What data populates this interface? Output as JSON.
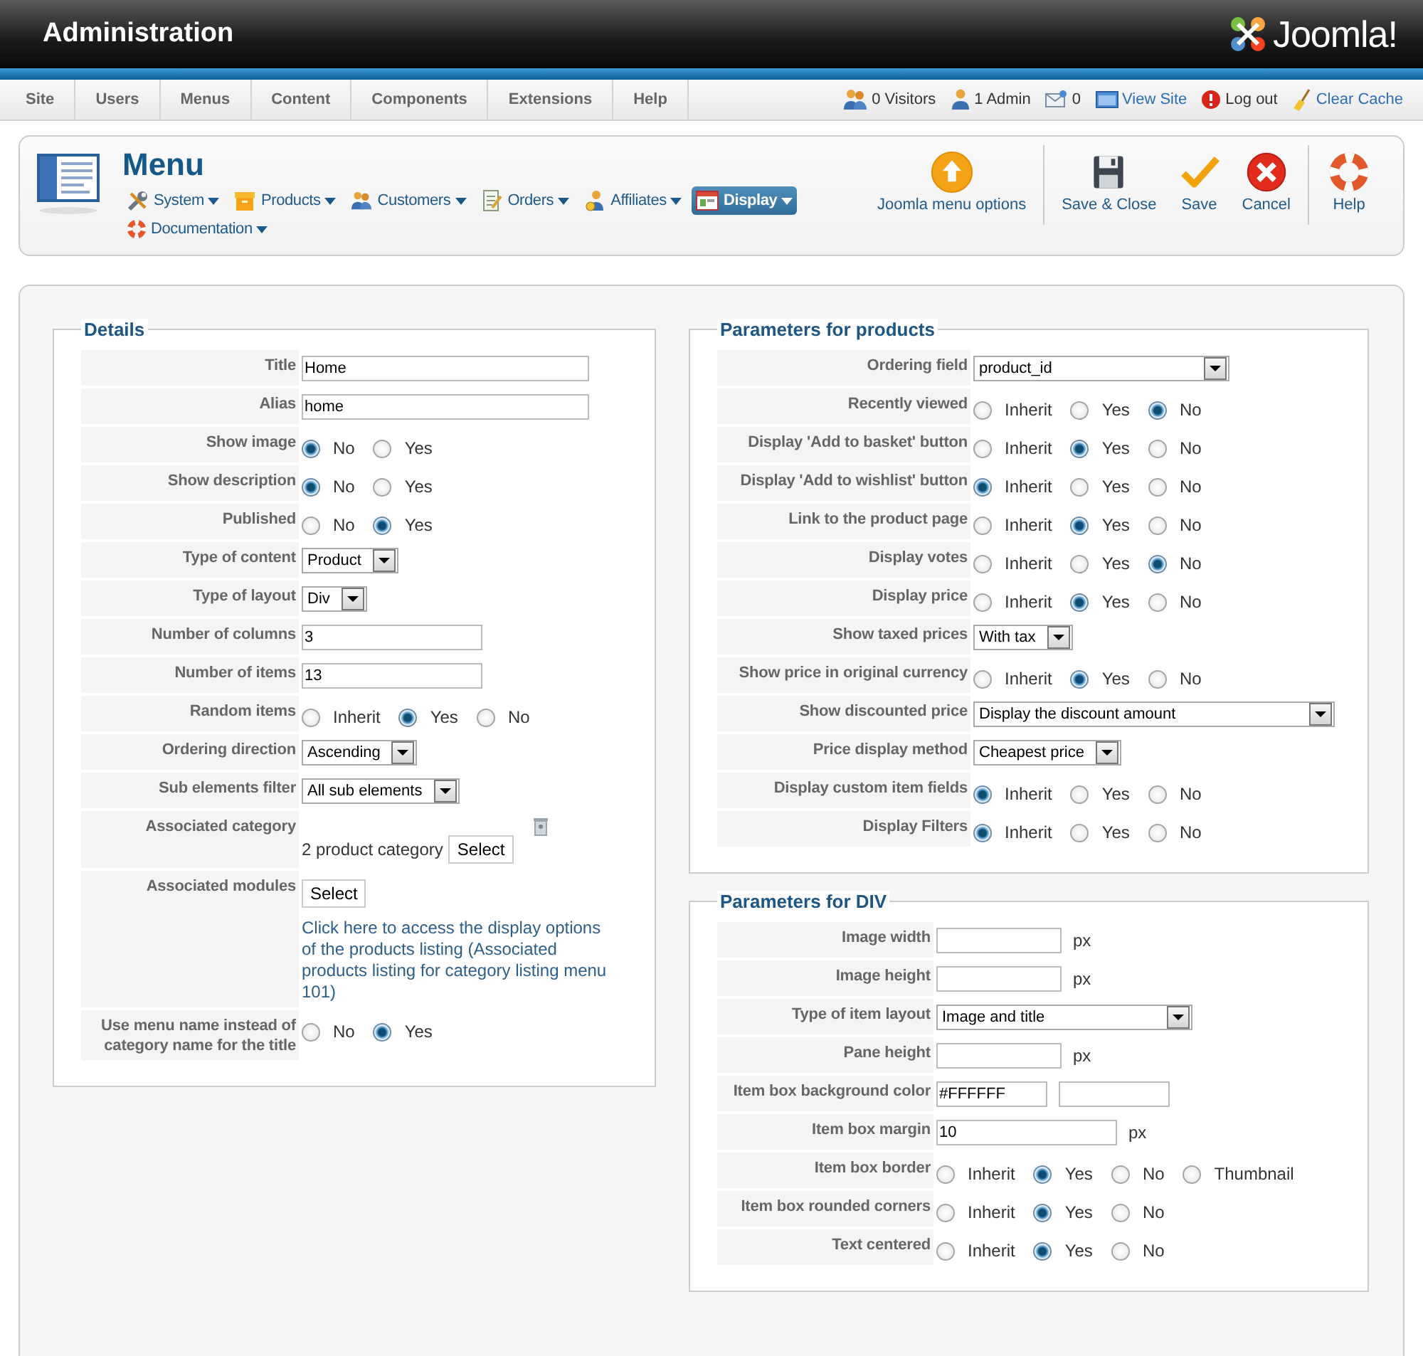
{
  "header": {
    "title": "Administration",
    "logo": "Joomla!"
  },
  "menu": [
    "Site",
    "Users",
    "Menus",
    "Content",
    "Components",
    "Extensions",
    "Help"
  ],
  "status": [
    {
      "kind": "visitors",
      "text": "0 Visitors"
    },
    {
      "kind": "admin",
      "text": "1 Admin"
    },
    {
      "kind": "messages",
      "text": "0"
    },
    {
      "kind": "view-site",
      "text": "View Site"
    },
    {
      "kind": "logout",
      "text": "Log out"
    },
    {
      "kind": "cache",
      "text": "Clear Cache"
    }
  ],
  "toolbar": {
    "title": "Menu",
    "nav": [
      {
        "label": "System",
        "kind": "tools",
        "selected": false
      },
      {
        "label": "Products",
        "kind": "box",
        "selected": false
      },
      {
        "label": "Customers",
        "kind": "people",
        "selected": false
      },
      {
        "label": "Orders",
        "kind": "document",
        "selected": false
      },
      {
        "label": "Affiliates",
        "kind": "coin",
        "selected": false
      },
      {
        "label": "Display",
        "kind": "window",
        "selected": true
      },
      {
        "label": "Documentation",
        "kind": "lifebuoy",
        "selected": false
      }
    ],
    "buttons": [
      {
        "kind": "options",
        "label": "Joomla menu options"
      },
      {
        "kind": "save-close",
        "label": "Save & Close"
      },
      {
        "kind": "save",
        "label": "Save"
      },
      {
        "kind": "cancel",
        "label": "Cancel"
      },
      {
        "kind": "help",
        "label": "Help"
      }
    ]
  },
  "details": {
    "legend": "Details",
    "rows": [
      {
        "kind": "text",
        "label": "Title",
        "value": "Home"
      },
      {
        "kind": "text",
        "label": "Alias",
        "value": "home"
      },
      {
        "kind": "radio",
        "label": "Show image",
        "options": [
          {
            "label": "No",
            "selected": true
          },
          {
            "label": "Yes",
            "selected": false
          }
        ]
      },
      {
        "kind": "radio",
        "label": "Show description",
        "options": [
          {
            "label": "No",
            "selected": true
          },
          {
            "label": "Yes",
            "selected": false
          }
        ]
      },
      {
        "kind": "radio",
        "label": "Published",
        "options": [
          {
            "label": "No",
            "selected": false
          },
          {
            "label": "Yes",
            "selected": true
          }
        ]
      },
      {
        "kind": "select",
        "label": "Type of content",
        "value": "Product"
      },
      {
        "kind": "select",
        "label": "Type of layout",
        "value": "Div"
      },
      {
        "kind": "short-text",
        "label": "Number of columns",
        "value": "3"
      },
      {
        "kind": "short-text",
        "label": "Number of items",
        "value": "13"
      },
      {
        "kind": "radio",
        "label": "Random items",
        "options": [
          {
            "label": "Inherit",
            "selected": false
          },
          {
            "label": "Yes",
            "selected": true
          },
          {
            "label": "No",
            "selected": false
          }
        ]
      },
      {
        "kind": "select",
        "label": "Ordering direction",
        "value": "Ascending"
      },
      {
        "kind": "select",
        "label": "Sub elements filter",
        "value": "All sub elements"
      },
      {
        "kind": "category",
        "label": "Associated category",
        "text": "2 product category",
        "button": "Select"
      },
      {
        "kind": "modules",
        "label": "Associated modules",
        "button": "Select",
        "link": "Click here to access the display options of the products listing (Associated products listing for category listing menu 101)"
      },
      {
        "kind": "radio",
        "label": "Use menu name instead of category name for the title",
        "options": [
          {
            "label": "No",
            "selected": false
          },
          {
            "label": "Yes",
            "selected": true
          }
        ]
      }
    ]
  },
  "product_parameters": {
    "legend": "Parameters for products",
    "rows": [
      {
        "kind": "wide-select",
        "label": "Ordering field",
        "value": "product_id"
      },
      {
        "kind": "radio",
        "label": "Recently viewed",
        "options": [
          {
            "label": "Inherit",
            "selected": false
          },
          {
            "label": "Yes",
            "selected": false
          },
          {
            "label": "No",
            "selected": true
          }
        ]
      },
      {
        "kind": "radio",
        "label": "Display 'Add to basket' button",
        "options": [
          {
            "label": "Inherit",
            "selected": false
          },
          {
            "label": "Yes",
            "selected": true
          },
          {
            "label": "No",
            "selected": false
          }
        ]
      },
      {
        "kind": "radio",
        "label": "Display 'Add to wishlist' button",
        "options": [
          {
            "label": "Inherit",
            "selected": true
          },
          {
            "label": "Yes",
            "selected": false
          },
          {
            "label": "No",
            "selected": false
          }
        ]
      },
      {
        "kind": "radio",
        "label": "Link to the product page",
        "options": [
          {
            "label": "Inherit",
            "selected": false
          },
          {
            "label": "Yes",
            "selected": true
          },
          {
            "label": "No",
            "selected": false
          }
        ]
      },
      {
        "kind": "radio",
        "label": "Display votes",
        "options": [
          {
            "label": "Inherit",
            "selected": false
          },
          {
            "label": "Yes",
            "selected": false
          },
          {
            "label": "No",
            "selected": true
          }
        ]
      },
      {
        "kind": "radio",
        "label": "Display price",
        "options": [
          {
            "label": "Inherit",
            "selected": false
          },
          {
            "label": "Yes",
            "selected": true
          },
          {
            "label": "No",
            "selected": false
          }
        ]
      },
      {
        "kind": "select",
        "label": "Show taxed prices",
        "value": "With tax"
      },
      {
        "kind": "radio",
        "label": "Show price in original currency",
        "options": [
          {
            "label": "Inherit",
            "selected": false
          },
          {
            "label": "Yes",
            "selected": true
          },
          {
            "label": "No",
            "selected": false
          }
        ]
      },
      {
        "kind": "full-select",
        "label": "Show discounted price",
        "value": "Display the discount amount"
      },
      {
        "kind": "select",
        "label": "Price display method",
        "value": "Cheapest price"
      },
      {
        "kind": "radio",
        "label": "Display custom item fields",
        "options": [
          {
            "label": "Inherit",
            "selected": true
          },
          {
            "label": "Yes",
            "selected": false
          },
          {
            "label": "No",
            "selected": false
          }
        ]
      },
      {
        "kind": "radio",
        "label": "Display Filters",
        "options": [
          {
            "label": "Inherit",
            "selected": true
          },
          {
            "label": "Yes",
            "selected": false
          },
          {
            "label": "No",
            "selected": false
          }
        ]
      }
    ]
  },
  "div_parameters": {
    "legend": "Parameters for DIV",
    "rows": [
      {
        "kind": "unit",
        "label": "Image width",
        "unit": "px"
      },
      {
        "kind": "unit",
        "label": "Image height",
        "unit": "px"
      },
      {
        "kind": "wide-select",
        "label": "Type of item layout",
        "value": "Image and title"
      },
      {
        "kind": "unit",
        "label": "Pane height",
        "unit": "px"
      },
      {
        "kind": "color",
        "label": "Item box background color",
        "value": "#FFFFFF"
      },
      {
        "kind": "wide-unit",
        "label": "Item box margin",
        "value": "10",
        "unit": "px"
      },
      {
        "kind": "radio",
        "label": "Item box border",
        "options": [
          {
            "label": "Inherit",
            "selected": false
          },
          {
            "label": "Yes",
            "selected": true
          },
          {
            "label": "No",
            "selected": false
          },
          {
            "label": "Thumbnail",
            "selected": false
          }
        ]
      },
      {
        "kind": "radio",
        "label": "Item box rounded corners",
        "options": [
          {
            "label": "Inherit",
            "selected": false
          },
          {
            "label": "Yes",
            "selected": true
          },
          {
            "label": "No",
            "selected": false
          }
        ]
      },
      {
        "kind": "radio",
        "label": "Text centered",
        "options": [
          {
            "label": "Inherit",
            "selected": false
          },
          {
            "label": "Yes",
            "selected": true
          },
          {
            "label": "No",
            "selected": false
          }
        ]
      }
    ]
  }
}
